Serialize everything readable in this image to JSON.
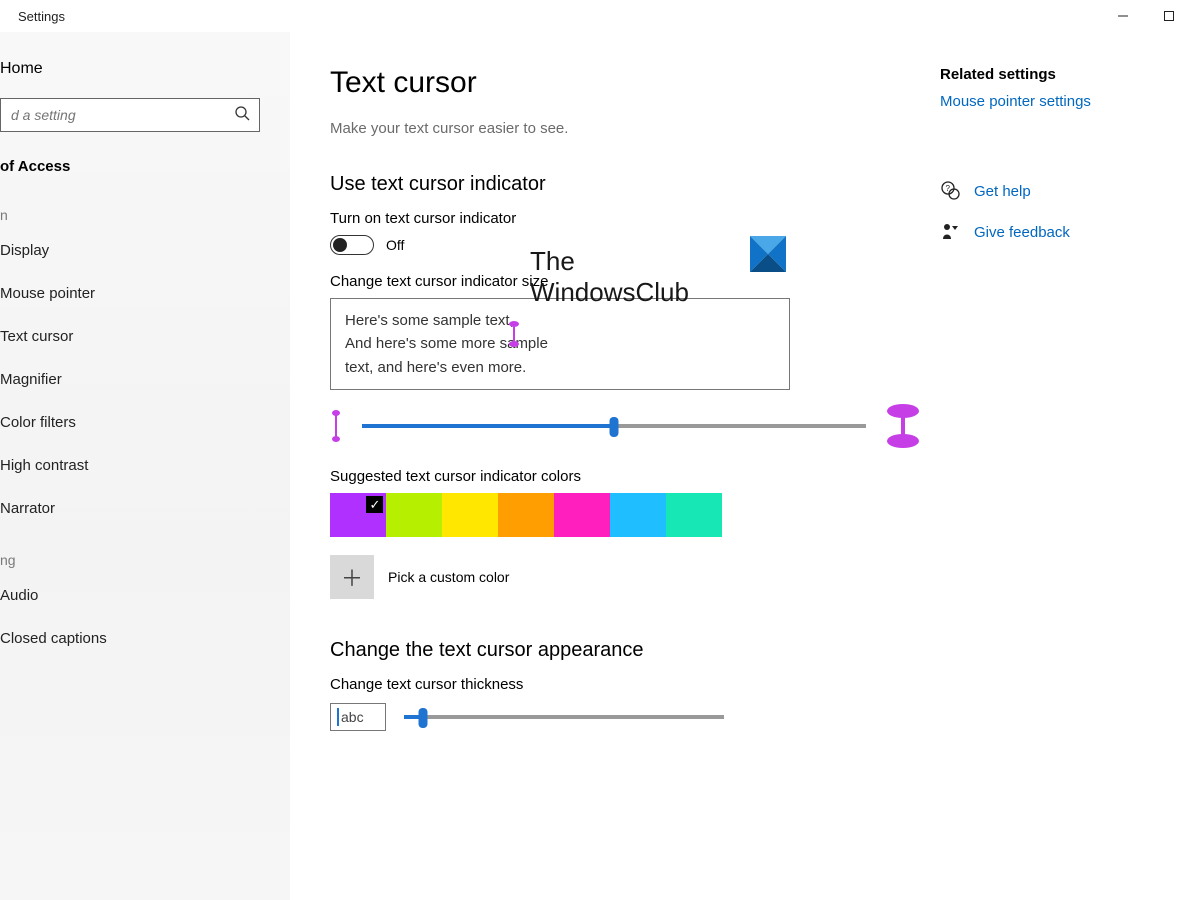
{
  "window": {
    "title": "Settings"
  },
  "sidebar": {
    "home": "Home",
    "search_placeholder": "d a setting",
    "category": "of Access",
    "subhead1": "n",
    "subhead2": "ng",
    "items": [
      {
        "label": "Display"
      },
      {
        "label": "Mouse pointer"
      },
      {
        "label": "Text cursor"
      },
      {
        "label": "Magnifier"
      },
      {
        "label": "Color filters"
      },
      {
        "label": "High contrast"
      },
      {
        "label": "Narrator"
      }
    ],
    "items2": [
      {
        "label": "Audio"
      },
      {
        "label": "Closed captions"
      }
    ]
  },
  "page": {
    "title": "Text cursor",
    "subtitle": "Make your text cursor easier to see.",
    "section1": "Use text cursor indicator",
    "toggle_label": "Turn on text cursor indicator",
    "toggle_state": "Off",
    "size_label": "Change text cursor indicator size",
    "preview_line1": "Here's some sample text,",
    "preview_line2": "And here's some more sample",
    "preview_line3": "text, and here's even more.",
    "colors_label": "Suggested text cursor indicator colors",
    "custom_label": "Pick a custom color",
    "section2": "Change the text cursor appearance",
    "thickness_label": "Change text cursor thickness",
    "abc_preview": "abc"
  },
  "suggested_colors": [
    "#b030ff",
    "#b6ef00",
    "#ffe700",
    "#ff9e00",
    "#ff1fbf",
    "#1fbfff",
    "#17e6b5"
  ],
  "aside": {
    "related_heading": "Related settings",
    "related_link": "Mouse pointer settings",
    "help": "Get help",
    "feedback": "Give feedback"
  },
  "watermark": {
    "line1": "The",
    "line2": "WindowsClub"
  }
}
